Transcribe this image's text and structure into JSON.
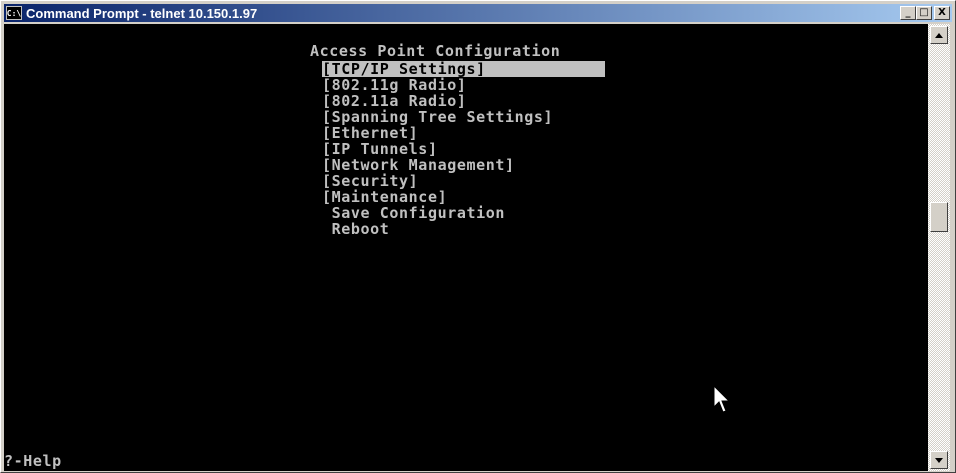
{
  "window": {
    "title": "Command Prompt - telnet 10.150.1.97",
    "icon_text": "C:\\",
    "buttons": {
      "minimize": "_",
      "maximize": "□",
      "close": "X"
    }
  },
  "terminal": {
    "heading": "Access Point Configuration",
    "menu": [
      {
        "label": "[TCP/IP Settings]",
        "selected": true
      },
      {
        "label": "[802.11g Radio]",
        "selected": false
      },
      {
        "label": "[802.11a Radio]",
        "selected": false
      },
      {
        "label": "[Spanning Tree Settings]",
        "selected": false
      },
      {
        "label": "[Ethernet]",
        "selected": false
      },
      {
        "label": "[IP Tunnels]",
        "selected": false
      },
      {
        "label": "[Network Management]",
        "selected": false
      },
      {
        "label": "[Security]",
        "selected": false
      },
      {
        "label": "[Maintenance]",
        "selected": false
      },
      {
        "label": " Save Configuration",
        "selected": false
      },
      {
        "label": " Reboot",
        "selected": false
      }
    ],
    "footer": "?-Help",
    "text_color": "#c0c0c0",
    "background": "#000000"
  },
  "scrollbar": {
    "up_icon": "up-arrow-icon",
    "down_icon": "down-arrow-icon"
  }
}
